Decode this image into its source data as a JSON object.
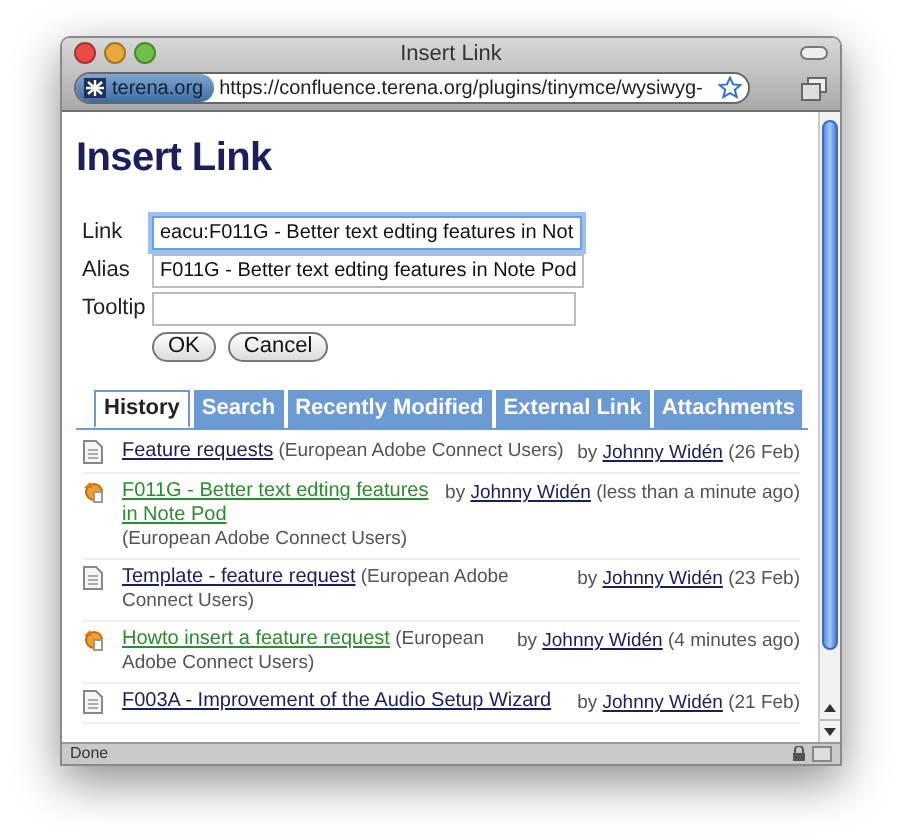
{
  "window": {
    "title": "Insert Link"
  },
  "toolbar": {
    "site": "terena.org",
    "url": "https://confluence.terena.org/plugins/tinymce/wysiwyg-"
  },
  "heading": "Insert Link",
  "form": {
    "fields": [
      {
        "label": "Link",
        "value": "eacu:F011G - Better text edting features in Not",
        "focused": true
      },
      {
        "label": "Alias",
        "value": "F011G - Better text edting features in Note Pod",
        "focused": false
      },
      {
        "label": "Tooltip",
        "focused": false
      }
    ],
    "buttons": [
      "OK",
      "Cancel"
    ]
  },
  "tabs": [
    {
      "label": "History",
      "selected": true
    },
    {
      "label": "Search",
      "selected": false
    },
    {
      "label": "Recently Modified",
      "selected": false
    },
    {
      "label": "External Link",
      "selected": false
    },
    {
      "label": "Attachments",
      "selected": false
    }
  ],
  "history": [
    {
      "kind": "page",
      "title": "Feature requests",
      "space": "(European Adobe Connect Users)",
      "by": "by",
      "author": "Johnny Widén",
      "when": "(26 Feb)"
    },
    {
      "kind": "recent",
      "title": "F011G - Better text edting features in Note Pod",
      "space": "(European Adobe Connect Users)",
      "by": "by",
      "author": "Johnny Widén",
      "when": "(less than a minute ago)"
    },
    {
      "kind": "page",
      "title": "Template - feature request",
      "space": "(European Adobe Connect Users)",
      "by": "by",
      "author": "Johnny Widén",
      "when": "(23 Feb)"
    },
    {
      "kind": "recent",
      "title": "Howto insert a feature request",
      "space": "(European Adobe Connect Users)",
      "by": "by",
      "author": "Johnny Widén",
      "when": "(4 minutes ago)"
    },
    {
      "kind": "page",
      "title": "F003A - Improvement of the Audio Setup Wizard",
      "by": "by",
      "author": "Johnny Widén",
      "when": "(21 Feb)"
    }
  ],
  "status_bar": {
    "text": "Done"
  }
}
